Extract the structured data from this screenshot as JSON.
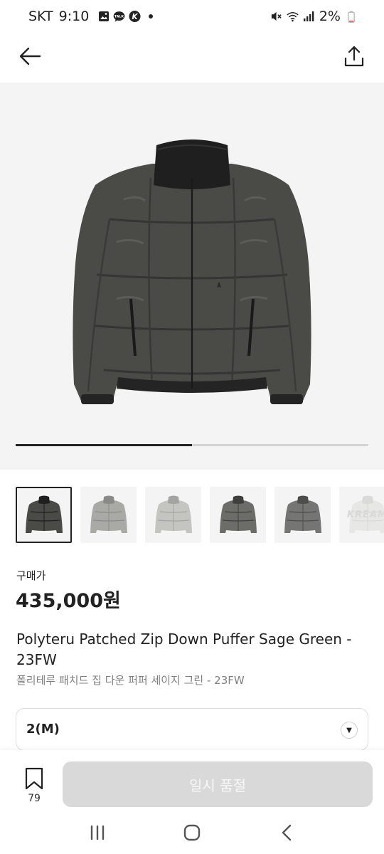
{
  "status_bar": {
    "carrier": "SKT",
    "time": "9:10",
    "battery": "2%",
    "left_icons": [
      "gallery-icon",
      "talk-icon",
      "kakao-k-icon",
      "dot-icon"
    ],
    "right_icons": [
      "mute-icon",
      "wifi-icon",
      "signal-icon",
      "battery-icon"
    ]
  },
  "app_bar": {
    "back_icon": "back-arrow-icon",
    "share_icon": "share-icon"
  },
  "hero": {
    "image_alt": "Dark sage green quilted puffer jacket with black high collar",
    "carousel_progress": 0.5
  },
  "thumbnails": [
    {
      "selected": true,
      "tone": "dark"
    },
    {
      "selected": false,
      "tone": "light"
    },
    {
      "selected": false,
      "tone": "lighter"
    },
    {
      "selected": false,
      "tone": "mid"
    },
    {
      "selected": false,
      "tone": "mid2"
    },
    {
      "selected": false,
      "tone": "faded",
      "mark": "KREAM"
    }
  ],
  "product": {
    "price_label": "구매가",
    "price": "435,000원",
    "title_en": "Polyteru Patched Zip Down Puffer Sage Green - 23FW",
    "title_ko": "폴리테루 패치드 집 다운 퍼퍼 세이지 그린 - 23FW"
  },
  "size_select": {
    "value": "2(M)"
  },
  "bottom_bar": {
    "bookmark_count": "79",
    "action_label": "일시 품절"
  },
  "nav_bar": {
    "icons": [
      "recent-apps-icon",
      "home-icon",
      "back-icon"
    ]
  }
}
